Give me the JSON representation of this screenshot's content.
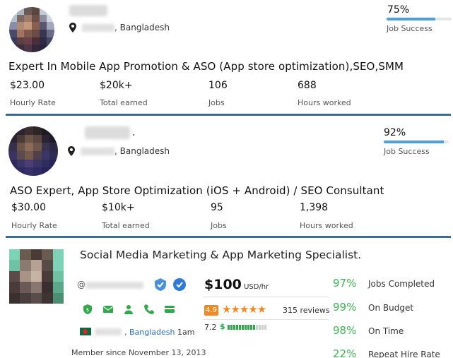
{
  "freelancers": [
    {
      "location_country": ", Bangladesh",
      "job_success_pct": "75%",
      "job_success_fraction": 0.75,
      "job_success_label": "Job Success",
      "title": "Expert In Mobile App Promotion & ASO (App store optimization),SEO,SMM",
      "stats": [
        {
          "value": "$23.00",
          "label": "Hourly Rate"
        },
        {
          "value": "$20k+",
          "label": "Total earned"
        },
        {
          "value": "106",
          "label": "Jobs"
        },
        {
          "value": "688",
          "label": "Hours worked"
        }
      ]
    },
    {
      "name_suffix": ".",
      "location_country": ", Bangladesh",
      "job_success_pct": "92%",
      "job_success_fraction": 0.92,
      "job_success_label": "Job Success",
      "title": "ASO Expert, App Store Optimization (iOS + Android) / SEO Consultant",
      "stats": [
        {
          "value": "$30.00",
          "label": "Hourly Rate"
        },
        {
          "value": "$10k+",
          "label": "Total earned"
        },
        {
          "value": "95",
          "label": "Jobs"
        },
        {
          "value": "1,398",
          "label": "Hours worked"
        }
      ]
    }
  ],
  "profile3": {
    "title": "Social Media Marketing & App Marketing Specialist.",
    "handle_prefix": "@",
    "price": "$100",
    "price_unit": " USD/hr",
    "rating": "4.9",
    "stars": "★★★★★",
    "reviews": "315 reviews",
    "score": "7.2",
    "earnings_symbol": "$",
    "earnings_level": 0.7,
    "location": ", Bangladesh",
    "local_time": " 1am",
    "member_since": "Member since November 13, 2013",
    "metrics": [
      {
        "pct": "97%",
        "label": "Jobs Completed"
      },
      {
        "pct": "99%",
        "label": "On Budget"
      },
      {
        "pct": "98%",
        "label": "On Time"
      },
      {
        "pct": "22%",
        "label": "Repeat Hire Rate"
      }
    ],
    "icon_names": [
      "shield-icon",
      "mail-icon",
      "user-icon",
      "phone-icon",
      "card-icon"
    ],
    "colors": {
      "accent_green": "#2eaa4a",
      "star_orange": "#ef8a23",
      "blue": "#2b6fb3",
      "separator": "#3d6b93"
    }
  }
}
